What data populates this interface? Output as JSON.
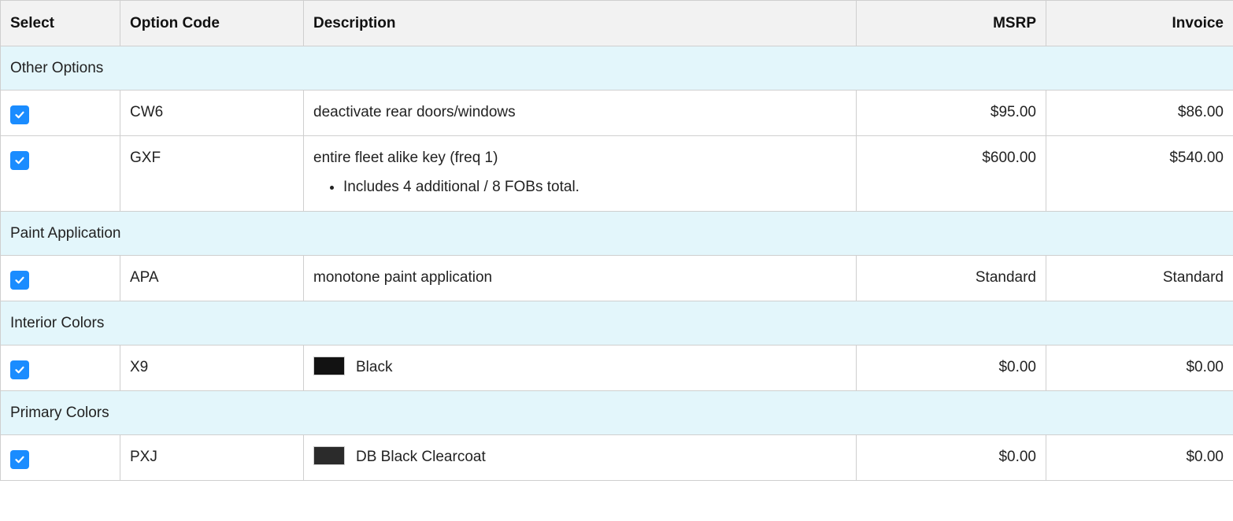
{
  "header": {
    "select": "Select",
    "option_code": "Option Code",
    "description": "Description",
    "msrp": "MSRP",
    "invoice": "Invoice"
  },
  "groups": [
    {
      "title": "Other Options",
      "items": [
        {
          "code": "CW6",
          "description": "deactivate rear doors/windows",
          "msrp": "$95.00",
          "invoice": "$86.00",
          "checked": true
        },
        {
          "code": "GXF",
          "description": "entire fleet alike key (freq 1)",
          "bullets": [
            "Includes 4 additional / 8 FOBs total."
          ],
          "msrp": "$600.00",
          "invoice": "$540.00",
          "checked": true
        }
      ]
    },
    {
      "title": "Paint Application",
      "items": [
        {
          "code": "APA",
          "description": "monotone paint application",
          "msrp": "Standard",
          "invoice": "Standard",
          "checked": true
        }
      ]
    },
    {
      "title": "Interior Colors",
      "items": [
        {
          "code": "X9",
          "description": "Black",
          "swatch": "#121212",
          "msrp": "$0.00",
          "invoice": "$0.00",
          "checked": true
        }
      ]
    },
    {
      "title": "Primary Colors",
      "items": [
        {
          "code": "PXJ",
          "description": "DB Black Clearcoat",
          "swatch": "#2b2b2b",
          "msrp": "$0.00",
          "invoice": "$0.00",
          "checked": true
        }
      ]
    }
  ],
  "colors": {
    "checkbox": "#1a8cff",
    "group_row": "#e3f6fb",
    "header_row": "#f2f2f2"
  }
}
